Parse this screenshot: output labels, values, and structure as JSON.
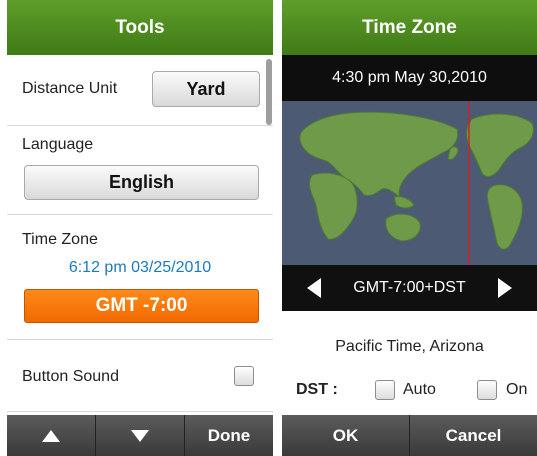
{
  "left": {
    "title": "Tools",
    "distance_unit": {
      "label": "Distance Unit",
      "value": "Yard"
    },
    "language": {
      "label": "Language",
      "value": "English"
    },
    "time_zone": {
      "label": "Time Zone",
      "datetime": "6:12 pm 03/25/2010",
      "value": "GMT -7:00"
    },
    "button_sound": {
      "label": "Button Sound",
      "checked": false
    },
    "bottom": {
      "up_icon": "up-arrow-icon",
      "down_icon": "down-arrow-icon",
      "done_label": "Done"
    }
  },
  "right": {
    "title": "Time Zone",
    "datetime": "4:30 pm May 30,2010",
    "zone": "GMT-7:00+DST",
    "zone_name": "Pacific Time, Arizona",
    "dst": {
      "label": "DST :",
      "auto_label": "Auto",
      "on_label": "On",
      "auto_checked": false,
      "on_checked": false
    },
    "bottom": {
      "ok_label": "OK",
      "cancel_label": "Cancel"
    }
  },
  "colors": {
    "header_green": "#4f8a20",
    "orange": "#f27a0a",
    "link_blue": "#1a7ac0",
    "map_bg": "#4d5a74",
    "land": "#6f9a4a"
  }
}
